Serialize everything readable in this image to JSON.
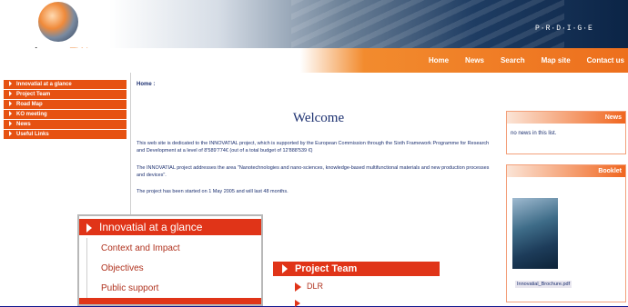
{
  "header": {
    "logo_main": "innova",
    "logo_accent": "Ti",
    "logo_tail": "Al",
    "prodige": "P·R·D·I·G·E"
  },
  "nav": {
    "items": [
      "Home",
      "News",
      "Search",
      "Map site",
      "Contact us"
    ]
  },
  "sidebar": {
    "items": [
      "Innovatial at a glance",
      "Project Team",
      "Road Map",
      "KO meeting",
      "News",
      "Useful Links"
    ]
  },
  "main": {
    "breadcrumb": "Home :",
    "title": "Welcome",
    "paragraphs": [
      "This web site is dedicated to the INNOVATIAL project, which is supported by the European Commission through the Sixth Framework Programme for Research and Development at a level of 8'589'774€ (out of a total budget of 12'888'539 €)",
      "The INNOVATIAL project addresses the area \"Nanotechnologies and nano-sciences, knowledge-based multifunctional materials and new production processes and devices\".",
      "The project has been started on 1 May 2005 and will last 48 months."
    ]
  },
  "news_box": {
    "title": "News",
    "body": "no news in this list."
  },
  "booklet_box": {
    "title": "Booklet",
    "caption": "Innovatial_Brochure.pdf"
  },
  "popup_glance": {
    "title": "Innovatial at a glance",
    "links": [
      "Context and Impact",
      "Objectives",
      "Public support"
    ]
  },
  "popup_team": {
    "title": "Project Team",
    "items": [
      "DLR"
    ]
  }
}
